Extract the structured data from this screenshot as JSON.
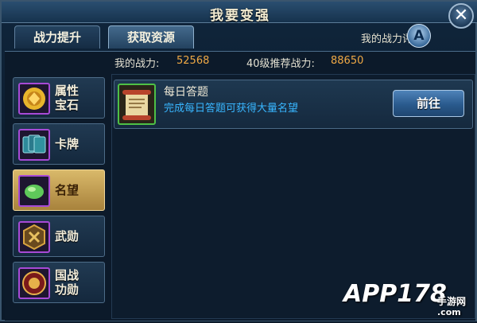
{
  "window": {
    "title": "我要变强"
  },
  "tabs": [
    {
      "label": "战力提升",
      "active": false
    },
    {
      "label": "获取资源",
      "active": true
    }
  ],
  "rating": {
    "label": "我的战力评分",
    "grade": "A"
  },
  "power": {
    "mine_label": "我的战力:",
    "mine_value": "52568",
    "recommend_label": "40级推荐战力:",
    "recommend_value": "88650"
  },
  "sidebar": {
    "items": [
      {
        "label": "属性宝石",
        "line1": "属性",
        "line2": "宝石",
        "icon": "gold-gem-icon",
        "selected": false
      },
      {
        "label": "卡牌",
        "line1": "卡牌",
        "line2": "",
        "icon": "cards-icon",
        "selected": false
      },
      {
        "label": "名望",
        "line1": "名望",
        "line2": "",
        "icon": "jade-icon",
        "selected": true
      },
      {
        "label": "武勋",
        "line1": "武勋",
        "line2": "",
        "icon": "war-medal-icon",
        "selected": false
      },
      {
        "label": "国战功勋",
        "line1": "国战",
        "line2": "功勋",
        "icon": "honor-medal-icon",
        "selected": false
      }
    ]
  },
  "tasks": [
    {
      "title": "每日答题",
      "description": "完成每日答题可获得大量名望",
      "button": "前往",
      "icon": "scroll-icon"
    }
  ],
  "watermark": {
    "brand": "APP178",
    "sub": "手游网",
    "dotcom": ".com"
  },
  "colors": {
    "accent_value": "#f0a945",
    "description": "#38b6ff",
    "icon_border_purple": "#a74ad6",
    "icon_border_green": "#4ec046",
    "selected_tab": "#d9b96a"
  }
}
